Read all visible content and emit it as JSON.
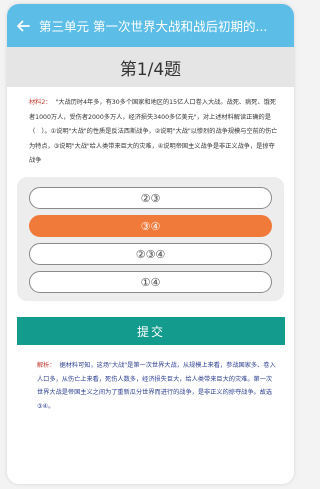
{
  "topbar": {
    "title": "第三单元 第一次世界大战和战后初期的..."
  },
  "progress": {
    "label": "第1/4题"
  },
  "question": {
    "tag": "材料2：",
    "text": "\"大战历时4年多，有30多个国家和地区的15亿人口卷入大战。战死、病死、饿死者1000万人，受伤者2000多万人，经济损失3400多亿美元\"，对上述材料解读正确的是（　）。①说明\"大战\"的性质是反法西斯战争，②说明\"大战\"以惨烈的战争规模与空前的伤亡为特点，③说明\"大战\"给人类带来巨大的灾难，④说明帝国主义战争是非正义战争，是掠夺战争"
  },
  "options": [
    {
      "label": "②③",
      "selected": false
    },
    {
      "label": "③④",
      "selected": true
    },
    {
      "label": "②③④",
      "selected": false
    },
    {
      "label": "①④",
      "selected": false
    }
  ],
  "submit": {
    "label": "提交"
  },
  "explanation": {
    "tag": "解析：",
    "text": "据材料可知，这场\"大战\"是第一次世界大战，从规模上来看，参战国家多、卷入人口多，从伤亡上来看，死伤人数多，经济损失巨大，给人类带来巨大的灾难。第一次世界大战是帝国主义之间为了重新瓜分世界而进行的战争，是非正义的掠夺战争。故选③④。"
  },
  "colors": {
    "topbar": "#5cbde7",
    "selected_option": "#f07a3a",
    "submit": "#139b8d"
  }
}
